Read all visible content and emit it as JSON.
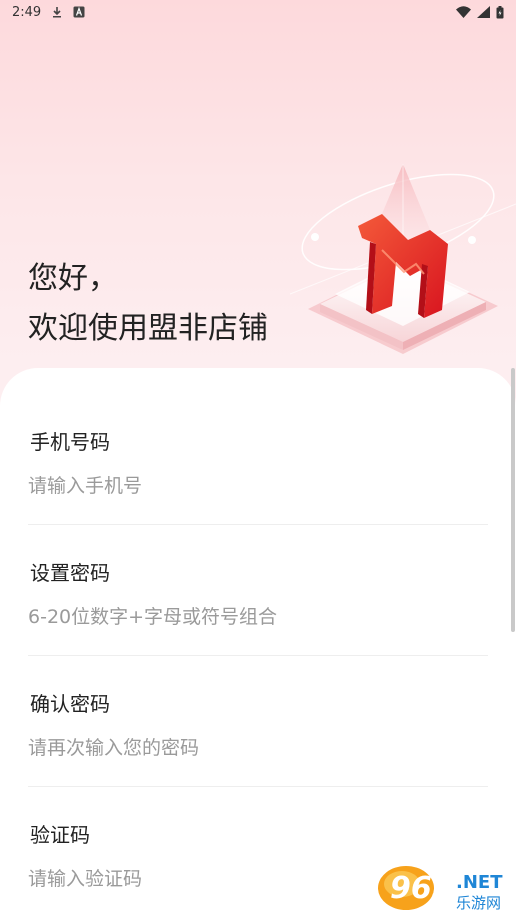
{
  "status_bar": {
    "time": "2:49",
    "icons": [
      "download-icon",
      "font-a-icon",
      "wifi-icon",
      "signal-icon",
      "battery-icon"
    ]
  },
  "header": {
    "greeting_line1": "您好，",
    "greeting_line2": "欢迎使用盟非店铺",
    "logo": "M-logo-3d-icon"
  },
  "form": {
    "phone": {
      "label": "手机号码",
      "placeholder": "请输入手机号",
      "value": ""
    },
    "password": {
      "label": "设置密码",
      "placeholder": "6-20位数字+字母或符号组合",
      "value": ""
    },
    "confirm_password": {
      "label": "确认密码",
      "placeholder": "请再次输入您的密码",
      "value": ""
    },
    "code": {
      "label": "验证码",
      "placeholder": "请输入验证码",
      "value": ""
    }
  },
  "watermark": {
    "number": "962",
    "suffix": ".NET",
    "subtitle": "乐游网"
  },
  "colors": {
    "accent": "#e8252e",
    "background_top": "#fdd9dc",
    "card": "#ffffff",
    "placeholder": "#9a9a9a"
  }
}
